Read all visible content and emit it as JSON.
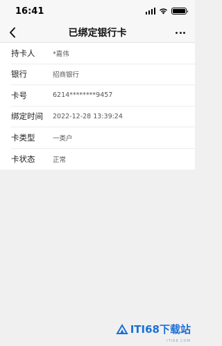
{
  "status_bar": {
    "time": "16:41"
  },
  "nav": {
    "title": "已绑定银行卡"
  },
  "rows": [
    {
      "label": "持卡人",
      "value": "*嘉伟"
    },
    {
      "label": "银行",
      "value": "招商银行"
    },
    {
      "label": "卡号",
      "value": "6214********9457"
    },
    {
      "label": "绑定时间",
      "value": "2022-12-28 13:39:24"
    },
    {
      "label": "卡类型",
      "value": "一类户"
    },
    {
      "label": "卡状态",
      "value": "正常"
    }
  ],
  "watermark": {
    "text": "ITI68下载站",
    "sub": "ITI68.COM"
  },
  "colors": {
    "watermark": "#1d6fd6",
    "background": "#f0f0f0"
  }
}
